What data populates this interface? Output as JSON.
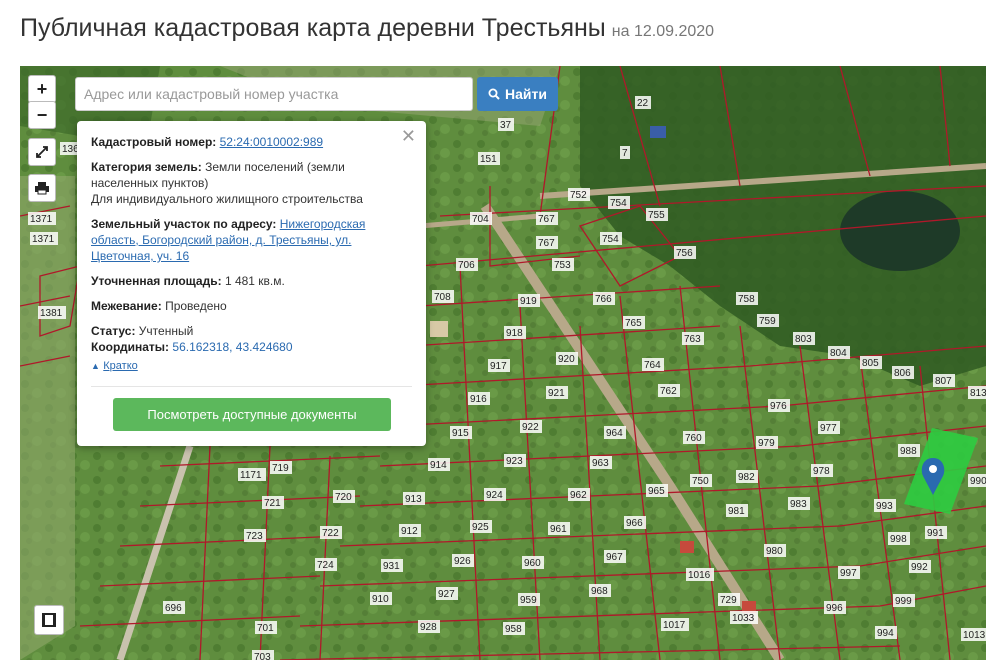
{
  "page": {
    "title": "Публичная кадастровая карта деревни Трестьяны",
    "date": "на 12.09.2020"
  },
  "controls": {
    "zoom_in": "+",
    "zoom_out": "−"
  },
  "search": {
    "placeholder": "Адрес или кадастровый номер участка",
    "button_label": "Найти"
  },
  "popup": {
    "cadastral_label": "Кадастровый номер:",
    "cadastral_value": "52:24:0010002:989",
    "category_label": "Категория земель:",
    "category_value": "Земли поселений (земли населенных пунктов)",
    "use_value": "Для индивидуального жилищного строительства",
    "address_label": "Земельный участок по адресу:",
    "address_value": "Нижегородская область, Богородский район, д. Трестьяны, ул. Цветочная, уч. 16",
    "area_label": "Уточненная площадь:",
    "area_value": "1 481 кв.м.",
    "survey_label": "Межевание:",
    "survey_value": "Проведено",
    "status_label": "Статус:",
    "status_value": "Учтенный",
    "coords_label": "Координаты:",
    "coords_value": "56.162318, 43.424680",
    "brief_link": "Кратко",
    "docs_button": "Посмотреть доступные документы"
  },
  "map": {
    "highlight_color": "#2ecc40",
    "boundary_color": "#b0182a",
    "marker_color": "#2a6ab0",
    "parcel_labels": [
      "37",
      "151",
      "7",
      "22",
      "752",
      "754",
      "767",
      "755",
      "704",
      "767",
      "754",
      "756",
      "706",
      "753",
      "708",
      "919",
      "766",
      "765",
      "918",
      "917",
      "920",
      "921",
      "916",
      "764",
      "763",
      "762",
      "758",
      "759",
      "803",
      "804",
      "805",
      "806",
      "807",
      "813",
      "976",
      "977",
      "979",
      "978",
      "988",
      "982",
      "983",
      "915",
      "922",
      "964",
      "760",
      "914",
      "923",
      "963",
      "719",
      "720",
      "1171",
      "721",
      "924",
      "913",
      "962",
      "965",
      "750",
      "981",
      "993",
      "990",
      "991",
      "723",
      "722",
      "912",
      "925",
      "961",
      "966",
      "980",
      "998",
      "992",
      "724",
      "931",
      "926",
      "960",
      "967",
      "1016",
      "997",
      "729",
      "696",
      "910",
      "927",
      "959",
      "968",
      "996",
      "999",
      "701",
      "928",
      "958",
      "1017",
      "1033",
      "994",
      "1013",
      "703",
      "1371",
      "1371",
      "1381",
      "136"
    ]
  }
}
